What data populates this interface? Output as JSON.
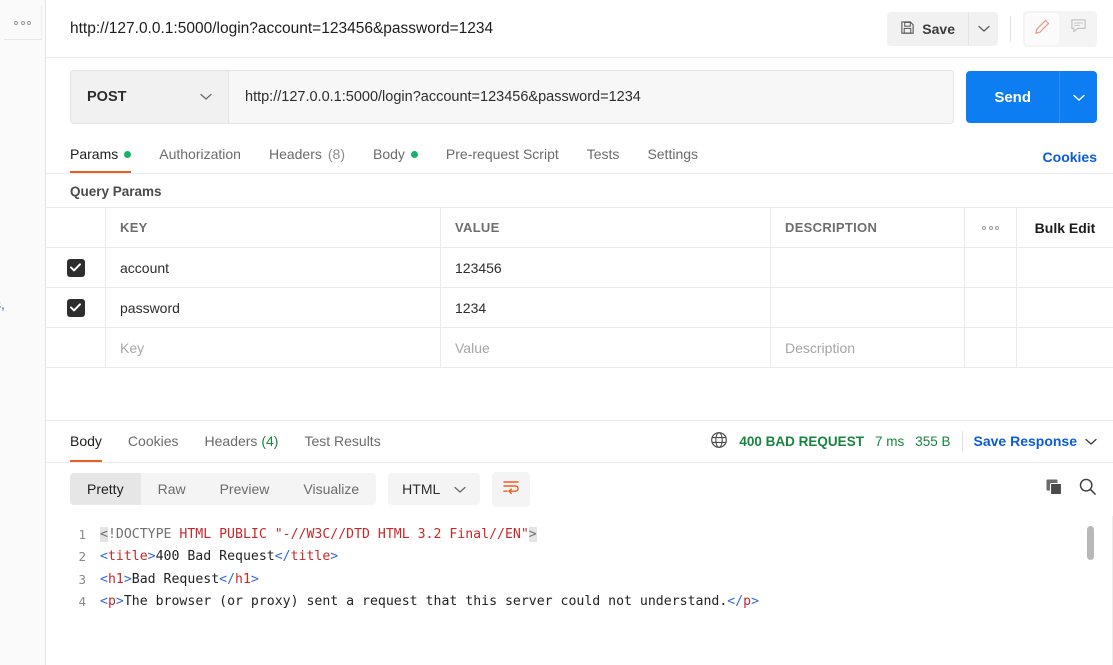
{
  "sidebar": {
    "menu_icon": "more-horizontal-icon",
    "clipped_text": "s",
    "clipped_comma": ","
  },
  "topbar": {
    "tab_title": "http://127.0.0.1:5000/login?account=123456&password=1234",
    "save_label": "Save",
    "save_icon": "floppy-disk-icon",
    "caret_icon": "chevron-down-icon",
    "edit_icon": "pencil-icon",
    "comment_icon": "comment-icon"
  },
  "request": {
    "method": "POST",
    "url": "http://127.0.0.1:5000/login?account=123456&password=1234",
    "send_label": "Send",
    "tabs": [
      {
        "label": "Params",
        "dot": true,
        "active": true
      },
      {
        "label": "Authorization",
        "dot": false,
        "active": false
      },
      {
        "label": "Headers",
        "count": "(8)",
        "dot": false,
        "active": false
      },
      {
        "label": "Body",
        "dot": true,
        "active": false
      },
      {
        "label": "Pre-request Script",
        "dot": false,
        "active": false
      },
      {
        "label": "Tests",
        "dot": false,
        "active": false
      },
      {
        "label": "Settings",
        "dot": false,
        "active": false
      }
    ],
    "cookies_link": "Cookies"
  },
  "query_params": {
    "section_label": "Query Params",
    "columns": {
      "key": "KEY",
      "value": "VALUE",
      "description": "DESCRIPTION"
    },
    "options_icon": "more-horizontal-icon",
    "bulk_edit": "Bulk Edit",
    "rows": [
      {
        "checked": true,
        "key": "account",
        "value": "123456",
        "description": ""
      },
      {
        "checked": true,
        "key": "password",
        "value": "1234",
        "description": ""
      }
    ],
    "placeholder_row": {
      "key": "Key",
      "value": "Value",
      "description": "Description"
    }
  },
  "response": {
    "tabs": [
      {
        "label": "Body",
        "active": true
      },
      {
        "label": "Cookies",
        "active": false
      },
      {
        "label": "Headers",
        "count": "(4)",
        "active": false
      },
      {
        "label": "Test Results",
        "active": false
      }
    ],
    "globe_icon": "globe-icon",
    "status": "400 BAD REQUEST",
    "time": "7 ms",
    "size": "355 B",
    "save_response": "Save Response",
    "view_modes": [
      {
        "label": "Pretty",
        "active": true
      },
      {
        "label": "Raw",
        "active": false
      },
      {
        "label": "Preview",
        "active": false
      },
      {
        "label": "Visualize",
        "active": false
      }
    ],
    "language": "HTML",
    "wrap_icon": "word-wrap-icon",
    "copy_icon": "copy-icon",
    "search_icon": "search-icon",
    "body_lines": [
      {
        "n": "1",
        "segments": [
          {
            "t": "<",
            "c": "tk-gray tk-hl"
          },
          {
            "t": "!DOCTYPE ",
            "c": "tk-gray"
          },
          {
            "t": "HTML PUBLIC \"-//W3C//DTD HTML 3.2 Final//EN\"",
            "c": "tk-red"
          },
          {
            "t": ">",
            "c": "tk-gray tk-hl"
          }
        ]
      },
      {
        "n": "2",
        "segments": [
          {
            "t": "<",
            "c": "tk-blue"
          },
          {
            "t": "title",
            "c": "tk-red"
          },
          {
            "t": ">",
            "c": "tk-blue"
          },
          {
            "t": "400 Bad Request",
            "c": ""
          },
          {
            "t": "</",
            "c": "tk-blue"
          },
          {
            "t": "title",
            "c": "tk-red"
          },
          {
            "t": ">",
            "c": "tk-blue"
          }
        ]
      },
      {
        "n": "3",
        "segments": [
          {
            "t": "<",
            "c": "tk-blue"
          },
          {
            "t": "h1",
            "c": "tk-red"
          },
          {
            "t": ">",
            "c": "tk-blue"
          },
          {
            "t": "Bad Request",
            "c": ""
          },
          {
            "t": "</",
            "c": "tk-blue"
          },
          {
            "t": "h1",
            "c": "tk-red"
          },
          {
            "t": ">",
            "c": "tk-blue"
          }
        ]
      },
      {
        "n": "4",
        "segments": [
          {
            "t": "<",
            "c": "tk-blue"
          },
          {
            "t": "p",
            "c": "tk-red"
          },
          {
            "t": ">",
            "c": "tk-blue"
          },
          {
            "t": "The browser (or proxy) sent a request that this server could not understand.",
            "c": ""
          },
          {
            "t": "</",
            "c": "tk-blue"
          },
          {
            "t": "p",
            "c": "tk-red"
          },
          {
            "t": ">",
            "c": "tk-blue"
          }
        ]
      }
    ]
  },
  "colors": {
    "accent_orange": "#ef5b25",
    "send_blue": "#0d7df2",
    "link_blue": "#0b5cd5",
    "status_green": "#17843f",
    "dot_green": "#17b169"
  }
}
